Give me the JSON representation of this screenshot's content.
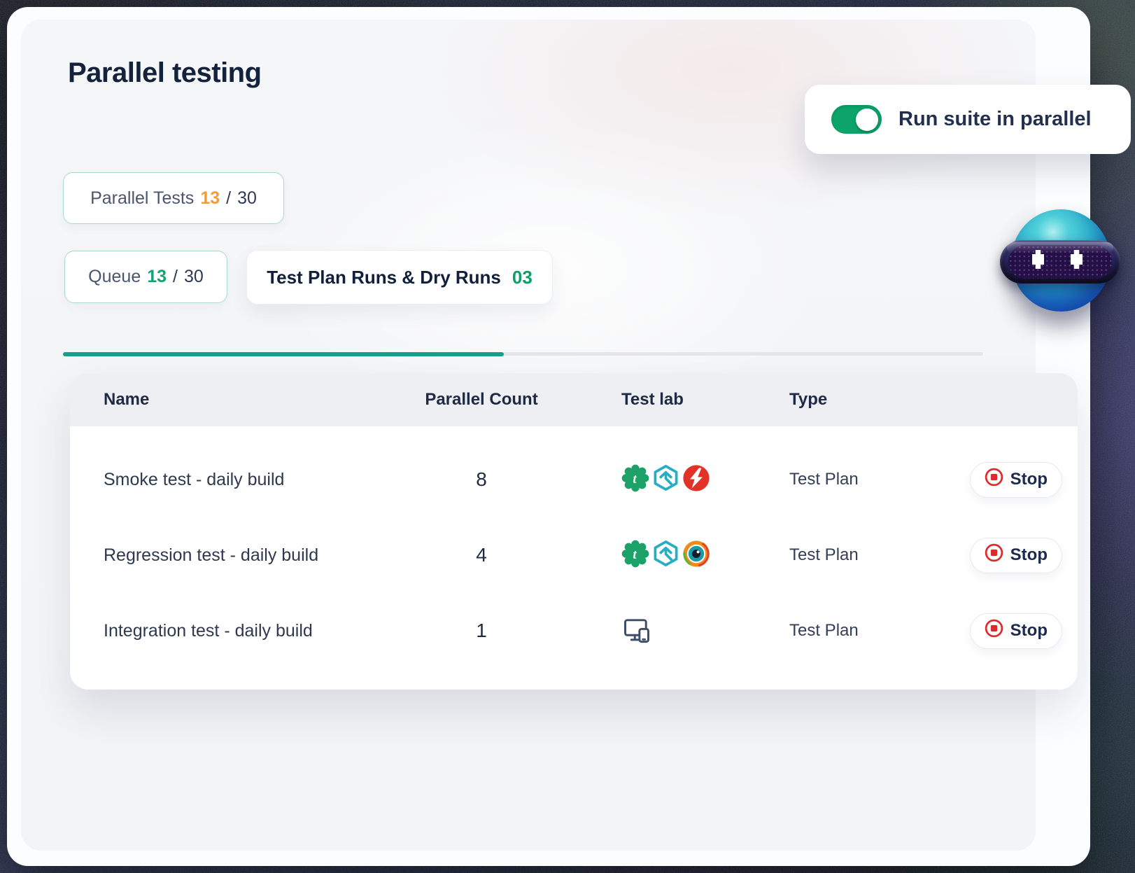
{
  "header": {
    "title": "Parallel testing"
  },
  "toggle": {
    "label": "Run suite in parallel",
    "state": "on",
    "color": "#0CA46A"
  },
  "stats": {
    "parallel_tests": {
      "label": "Parallel Tests",
      "current": "13",
      "separator": "/",
      "total": "30"
    },
    "queue": {
      "label": "Queue",
      "current": "13",
      "separator": "/",
      "total": "30"
    },
    "test_plan_runs": {
      "label": "Test Plan Runs & Dry Runs",
      "count": "03"
    }
  },
  "table": {
    "columns": [
      "Name",
      "Parallel Count",
      "Test lab",
      "Type"
    ],
    "rows": [
      {
        "name": "Smoke test - daily build",
        "parallel_count": "8",
        "test_lab_icons": [
          "testsigma-gear-icon",
          "hexagon-arrow-icon",
          "saucelabs-bolt-icon"
        ],
        "type": "Test Plan",
        "action": "Stop"
      },
      {
        "name": "Regression test - daily build",
        "parallel_count": "4",
        "test_lab_icons": [
          "testsigma-gear-icon",
          "hexagon-arrow-icon",
          "eye-icon"
        ],
        "type": "Test Plan",
        "action": "Stop"
      },
      {
        "name": "Integration test - daily build",
        "parallel_count": "1",
        "test_lab_icons": [
          "devices-icon"
        ],
        "type": "Test Plan",
        "action": "Stop"
      }
    ]
  },
  "icons": {
    "testsigma-gear-icon": "green gear with white t",
    "hexagon-arrow-icon": "teal hexagon with up arrow",
    "saucelabs-bolt-icon": "red circle with white lightning bolt",
    "eye-icon": "orange ringed eye with teal iris",
    "devices-icon": "monitor and phone outline",
    "stop-icon": "red circle with red square",
    "mascot": "blue robot sphere with pixel eyes"
  },
  "colors": {
    "accent_green": "#0CA46A",
    "tab_active": "#12A089",
    "count_orange": "#F09B3C",
    "count_green": "#14A173",
    "stop_red": "#D92C2C",
    "navy": "#14223C"
  }
}
